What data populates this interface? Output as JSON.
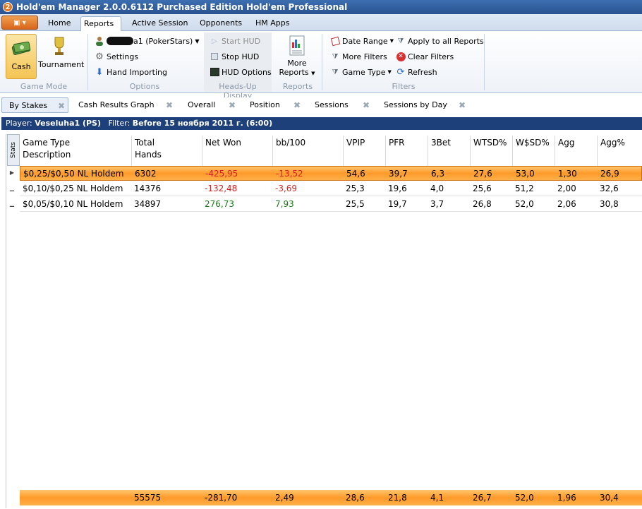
{
  "window": {
    "title": "Hold'em Manager 2.0.0.6112 Purchased Edition Hold'em Professional",
    "app_badge": "2"
  },
  "ribbon_tabs": [
    "Home",
    "Reports",
    "Active Session",
    "Opponents",
    "HM Apps"
  ],
  "ribbon": {
    "game_mode": {
      "cash": "Cash",
      "tournament": "Tournament",
      "label": "Game Mode"
    },
    "options": {
      "player": "a1 (PokerStars)",
      "settings": "Settings",
      "hand_importing": "Hand Importing",
      "label": "Options"
    },
    "hud": {
      "start": "Start HUD",
      "stop": "Stop HUD",
      "options": "HUD Options",
      "label": "Heads-Up Display"
    },
    "reports": {
      "more_line1": "More",
      "more_line2": "Reports",
      "label": "Reports"
    },
    "filters": {
      "date_range": "Date Range",
      "apply_all": "Apply to all Reports",
      "more_filters": "More Filters",
      "clear_filters": "Clear Filters",
      "game_type": "Game Type",
      "refresh": "Refresh",
      "label": "Filters"
    }
  },
  "report_tabs": [
    "By Stakes",
    "Cash Results Graph",
    "Overall",
    "Position",
    "Sessions",
    "Sessions by Day"
  ],
  "player_bar": {
    "player_label": "Player:",
    "player": "Veseluha1 (PS)",
    "filter_label": "Filter:",
    "filter": "Before 15 ноября 2011 г. (6:00)"
  },
  "grid": {
    "stats_tab": "Stats",
    "headers": [
      [
        "Game Type",
        "Description"
      ],
      [
        "Total",
        "Hands"
      ],
      [
        "Net Won",
        ""
      ],
      [
        "bb/100",
        ""
      ],
      [
        "VPIP",
        ""
      ],
      [
        "PFR",
        ""
      ],
      [
        "3Bet",
        ""
      ],
      [
        "WTSD%",
        ""
      ],
      [
        "W$SD%",
        ""
      ],
      [
        "Agg",
        ""
      ],
      [
        "Agg%",
        ""
      ]
    ],
    "rows": [
      [
        "$0,25/$0,50 NL Holdem",
        "6302",
        "-425,95",
        "-13,52",
        "54,6",
        "39,7",
        "6,3",
        "27,6",
        "53,0",
        "1,30",
        "26,9"
      ],
      [
        "$0,10/$0,25 NL Holdem",
        "14376",
        "-132,48",
        "-3,69",
        "25,3",
        "19,6",
        "4,0",
        "25,6",
        "51,2",
        "2,00",
        "32,6"
      ],
      [
        "$0,05/$0,10 NL Holdem",
        "34897",
        "276,73",
        "7,93",
        "25,5",
        "19,7",
        "3,7",
        "26,8",
        "52,0",
        "2,06",
        "30,8"
      ]
    ],
    "totals": [
      "",
      "55575",
      "-281,70",
      "2,49",
      "28,6",
      "21,8",
      "4,1",
      "26,7",
      "52,0",
      "1,96",
      "30,4"
    ]
  },
  "colors": {
    "accent": "#ff9a2a",
    "titlebar": "#2a5290",
    "negative": "#d81e1e",
    "positive": "#1a7a1a"
  }
}
